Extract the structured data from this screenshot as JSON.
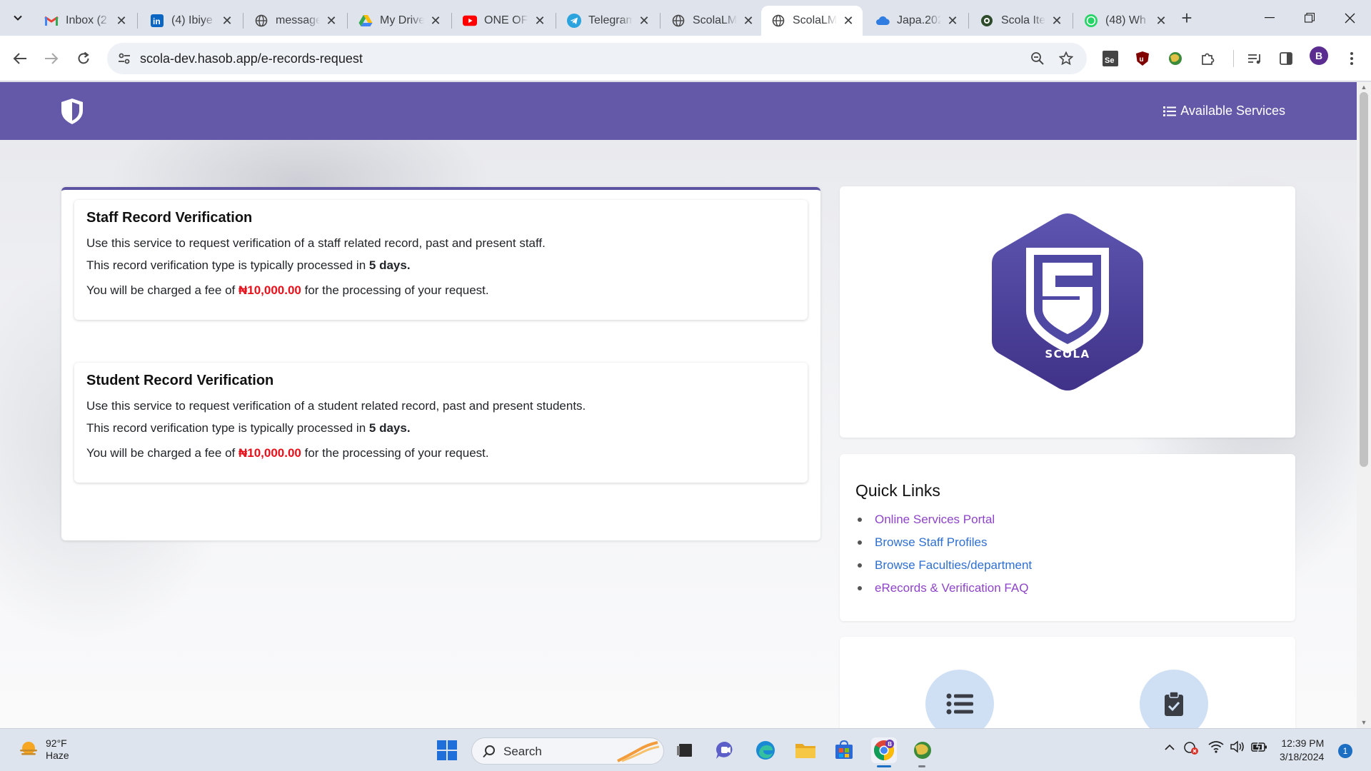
{
  "tabs": [
    {
      "title": "Inbox (2",
      "icon": "gmail-icon"
    },
    {
      "title": "(4) Ibiye",
      "icon": "linkedin-icon"
    },
    {
      "title": "message",
      "icon": "globe-icon"
    },
    {
      "title": "My Drive",
      "icon": "drive-icon"
    },
    {
      "title": "ONE OF",
      "icon": "youtube-icon"
    },
    {
      "title": "Telegram",
      "icon": "telegram-icon"
    },
    {
      "title": "ScolaLM",
      "icon": "globe-icon"
    },
    {
      "title": "ScolaLM",
      "icon": "globe-icon",
      "active": true
    },
    {
      "title": "Japa.202",
      "icon": "cloud-icon"
    },
    {
      "title": "Scola Ite",
      "icon": "globe-icon"
    },
    {
      "title": "(48) Wh",
      "icon": "whatsapp-icon"
    }
  ],
  "address_bar": {
    "url": "scola-dev.hasob.app/e-records-request"
  },
  "profile_initial": "B",
  "header": {
    "nav_label": "Available Services"
  },
  "services": [
    {
      "title": "Staff Record Verification",
      "description": "Use this service to request verification of a staff related record, past and present staff.",
      "processing_prefix": "This record verification type is typically processed in",
      "processing_time": "5 days.",
      "fee_prefix": "You will be charged a fee of",
      "fee": "₦10,000.00",
      "fee_suffix": "for the processing of your request."
    },
    {
      "title": "Student Record Verification",
      "description": "Use this service to request verification of a student related record, past and present students.",
      "processing_prefix": "This record verification type is typically processed in",
      "processing_time": "5 days.",
      "fee_prefix": "You will be charged a fee of",
      "fee": "₦10,000.00",
      "fee_suffix": "for the processing of your request."
    }
  ],
  "brand": {
    "logo_text": "SCOLA",
    "color": "#5a4ea6"
  },
  "quick_links": {
    "title": "Quick Links",
    "items": [
      {
        "label": "Online Services Portal"
      },
      {
        "label": "Browse Staff Profiles"
      },
      {
        "label": "Browse Faculties/department"
      },
      {
        "label": "eRecords & Verification FAQ"
      }
    ]
  },
  "taskbar": {
    "weather_temp": "92°F",
    "weather_desc": "Haze",
    "search_label": "Search",
    "time": "12:39 PM",
    "date": "3/18/2024",
    "notification_count": "1"
  },
  "colors": {
    "header": "#6359a8",
    "accent": "#5c54a3",
    "fee": "#e8111b",
    "link_purple": "#8e44c9",
    "link_blue": "#2f6fd1"
  }
}
